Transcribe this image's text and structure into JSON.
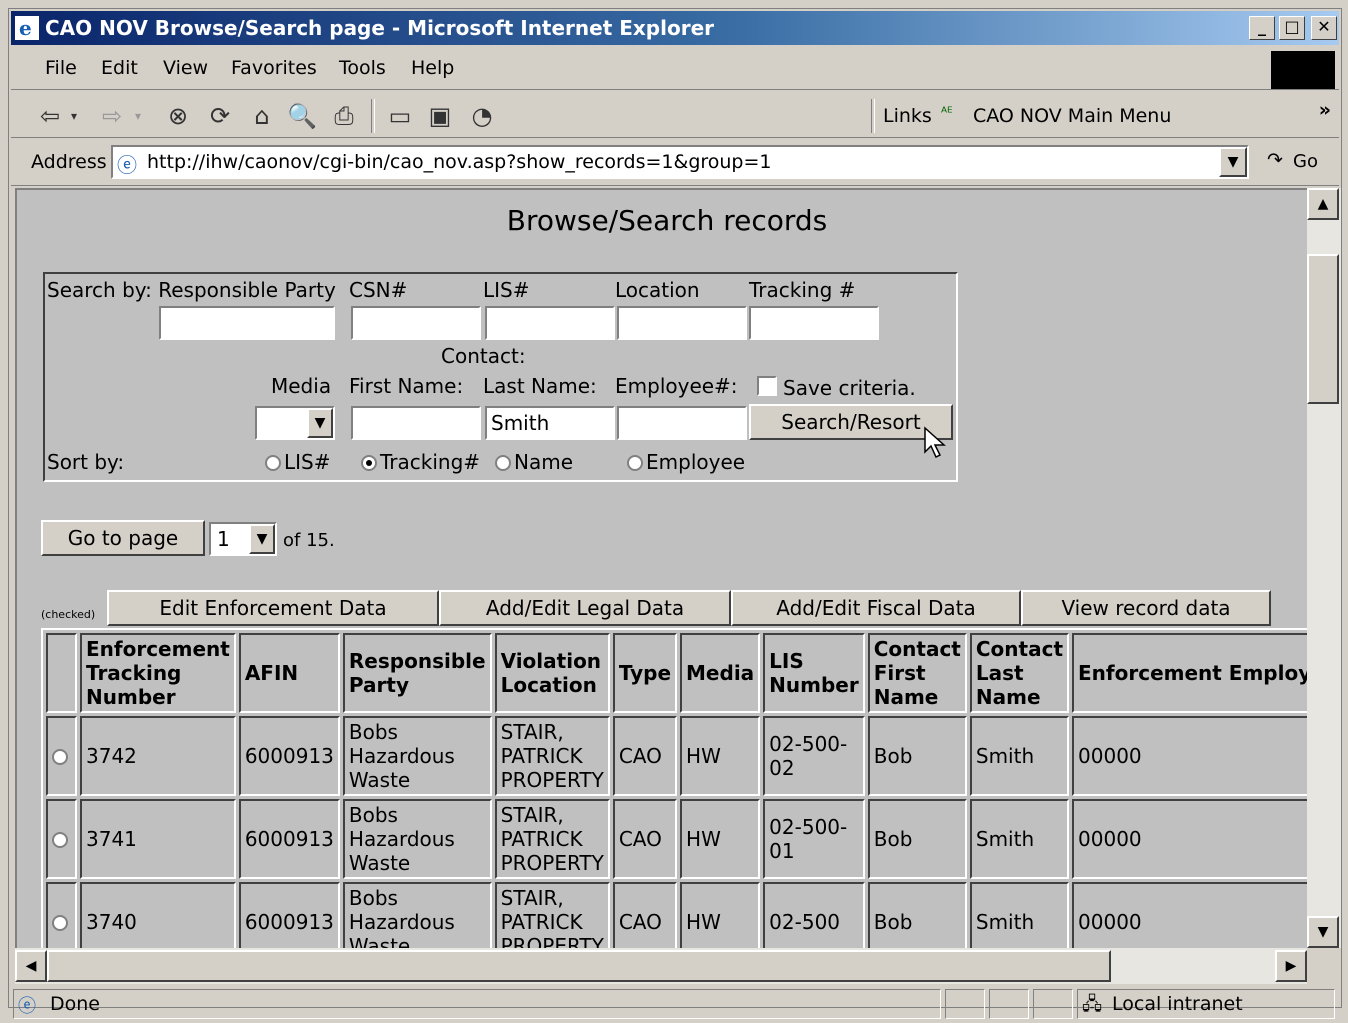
{
  "window": {
    "title": "CAO NOV Browse/Search page - Microsoft Internet Explorer"
  },
  "menu": [
    "File",
    "Edit",
    "View",
    "Favorites",
    "Tools",
    "Help"
  ],
  "links": {
    "label": "Links",
    "item": "CAO NOV Main Menu"
  },
  "address": {
    "label": "Address",
    "url": "http://ihw/caonov/cgi-bin/cao_nov.asp?show_records=1&group=1",
    "go": "Go"
  },
  "page": {
    "heading": "Browse/Search records",
    "search_by": "Search by: Responsible Party",
    "csn": "CSN#",
    "lis": "LIS#",
    "location": "Location",
    "tracking": "Tracking #",
    "contact": "Contact:",
    "media": "Media",
    "first_name": "First Name:",
    "last_name": "Last Name:",
    "employee": "Employee#:",
    "last_name_value": "Smith",
    "save_criteria": "Save criteria.",
    "search_resort": "Search/Resort",
    "sort_by": "Sort by:",
    "sort_options": [
      "LIS#",
      "Tracking#",
      "Name",
      "Employee"
    ],
    "goto_page": "Go to page",
    "page_value": "1",
    "of_pages": "of 15.",
    "checked": "(checked)",
    "actions": [
      "Edit Enforcement Data",
      "Add/Edit Legal Data",
      "Add/Edit Fiscal Data",
      "View record data"
    ]
  },
  "table": {
    "headers": [
      "Enforcement Tracking Number",
      "AFIN",
      "Responsible Party",
      "Violation Location",
      "Type",
      "Media",
      "LIS Number",
      "Contact First Name",
      "Contact Last Name",
      "Enforcement Employee"
    ],
    "rows": [
      [
        "3742",
        "6000913",
        "Bobs Hazardous Waste",
        "STAIR, PATRICK PROPERTY",
        "CAO",
        "HW",
        "02-500-02",
        "Bob",
        "Smith",
        "00000"
      ],
      [
        "3741",
        "6000913",
        "Bobs Hazardous Waste",
        "STAIR, PATRICK PROPERTY",
        "CAO",
        "HW",
        "02-500-01",
        "Bob",
        "Smith",
        "00000"
      ],
      [
        "3740",
        "6000913",
        "Bobs Hazardous Waste",
        "STAIR, PATRICK PROPERTY",
        "CAO",
        "HW",
        "02-500",
        "Bob",
        "Smith",
        "00000"
      ]
    ]
  },
  "status": {
    "text": "Done",
    "zone": "Local intranet"
  }
}
